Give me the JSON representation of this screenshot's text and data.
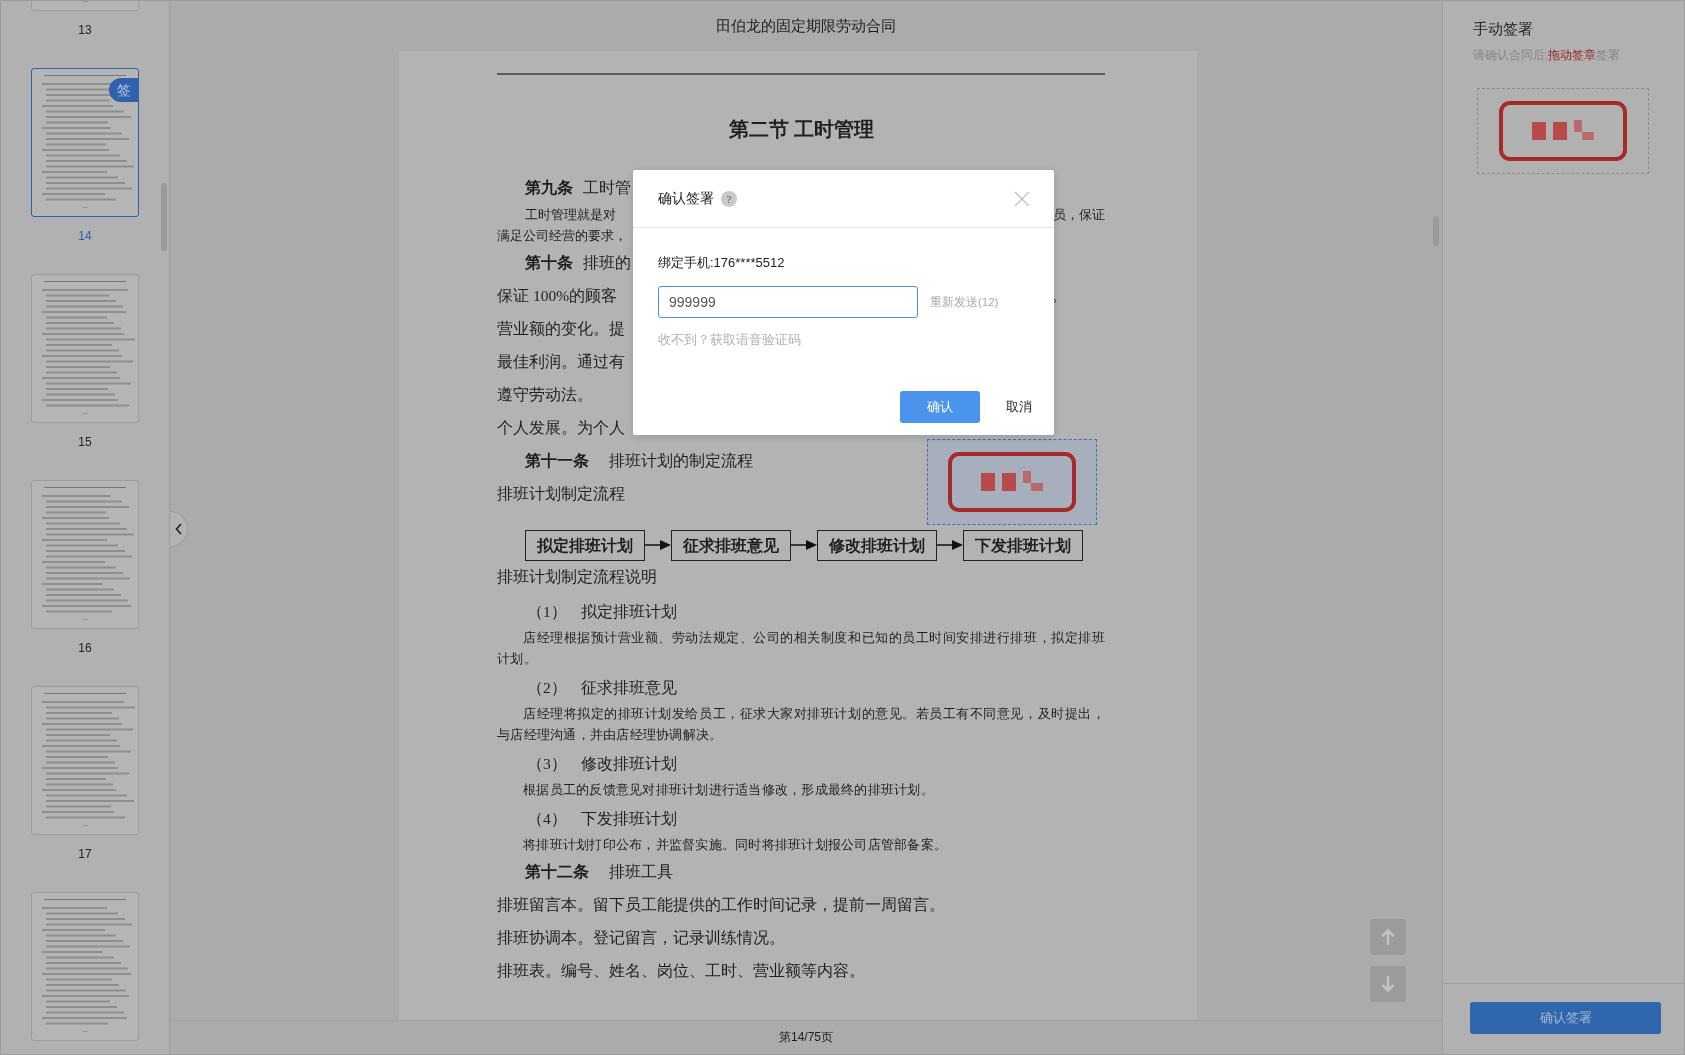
{
  "title": "田伯龙的固定期限劳动合同",
  "thumbnails": [
    {
      "page": "13",
      "selected": false
    },
    {
      "page": "14",
      "selected": true,
      "badge": "签"
    },
    {
      "page": "15",
      "selected": false
    },
    {
      "page": "16",
      "selected": false
    },
    {
      "page": "17",
      "selected": false
    },
    {
      "selected": false
    }
  ],
  "document": {
    "heading": "第二节  工时管理",
    "blocks": [
      {
        "kind": "article",
        "label": "第九条",
        "text": "工时管"
      },
      {
        "kind": "small",
        "text": "工时管理就是对",
        "right": "员，保证"
      },
      {
        "kind": "small-cont",
        "text": "满足公司经营的要求，"
      },
      {
        "kind": "article",
        "label": "第十条",
        "text": "排班的"
      },
      {
        "kind": "line",
        "text": "保证 100%的顾客",
        "right": "。"
      },
      {
        "kind": "line",
        "text": "营业额的变化。提"
      },
      {
        "kind": "line",
        "text": "最佳利润。通过有"
      },
      {
        "kind": "line",
        "text": "遵守劳动法。"
      },
      {
        "kind": "line",
        "text": "个人发展。为个人"
      },
      {
        "kind": "article",
        "label": "第十一条",
        "text": "排班计划的制定流程"
      },
      {
        "kind": "line",
        "text": "排班计划制定流程"
      },
      {
        "kind": "flow",
        "steps": [
          "拟定排班计划",
          "征求排班意见",
          "修改排班计划",
          "下发排班计划"
        ]
      },
      {
        "kind": "line",
        "text": "排班计划制定流程说明"
      },
      {
        "kind": "item",
        "label": "（1）",
        "text": "拟定排班计划"
      },
      {
        "kind": "small",
        "text": "店经理根据预计营业额、劳动法规定、公司的相关制度和已知的员工时间安排进行排班，拟定排班计划。"
      },
      {
        "kind": "item",
        "label": "（2）",
        "text": "征求排班意见"
      },
      {
        "kind": "small",
        "text": "店经理将拟定的排班计划发给员工，征求大家对排班计划的意见。若员工有不同意见，及时提出，与店经理沟通，并由店经理协调解决。"
      },
      {
        "kind": "item",
        "label": "（3）",
        "text": "修改排班计划"
      },
      {
        "kind": "small",
        "text": "根据员工的反馈意见对排班计划进行适当修改，形成最终的排班计划。"
      },
      {
        "kind": "item",
        "label": "（4）",
        "text": "下发排班计划"
      },
      {
        "kind": "small",
        "text": "将排班计划打印公布，并监督实施。同时将排班计划报公司店管部备案。"
      },
      {
        "kind": "article",
        "label": "第十二条",
        "text": "排班工具"
      },
      {
        "kind": "line",
        "text": "排班留言本。留下员工能提供的工作时间记录，提前一周留言。"
      },
      {
        "kind": "line",
        "text": "排班协调本。登记留言，记录训练情况。"
      },
      {
        "kind": "line",
        "text": "排班表。编号、姓名、岗位、工时、营业额等内容。"
      }
    ],
    "page_indicator": "第14/75页"
  },
  "panel": {
    "title": "手动签署",
    "hint": {
      "before": "请确认合同后,",
      "highlight": "拖动签章",
      "after": "签署"
    },
    "confirm": "确认签署"
  },
  "dialog": {
    "title": "确认签署",
    "help": "?",
    "phone": "绑定手机:176****5512",
    "code": {
      "value": "999999",
      "focused": true
    },
    "resend": "重新发送(12)",
    "voice": "收不到？获取语音验证码",
    "ok": "确认",
    "cancel": "取消"
  }
}
